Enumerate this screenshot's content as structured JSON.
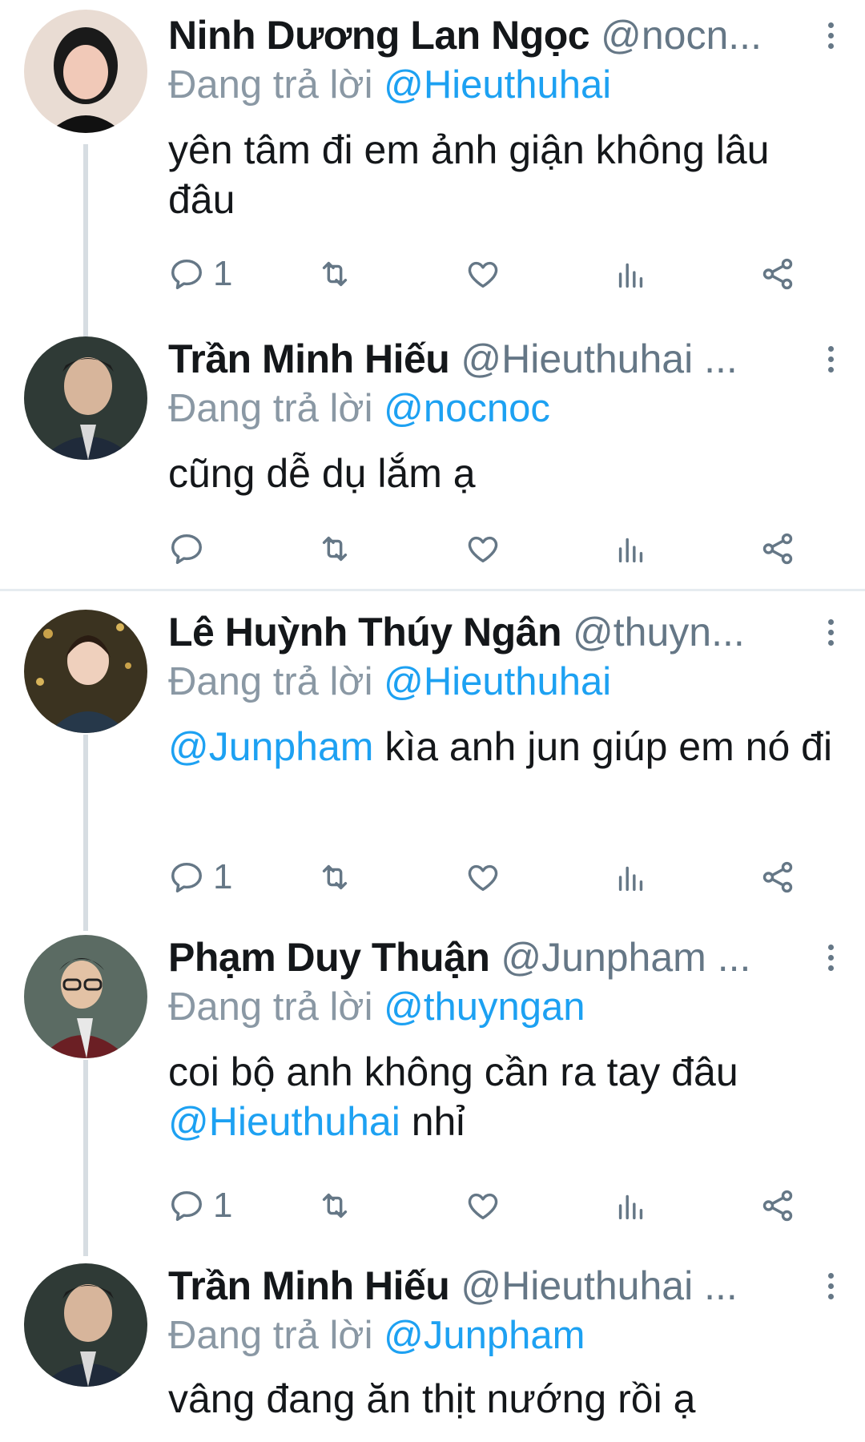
{
  "tweets": [
    {
      "name": "Ninh Dương Lan Ngọc",
      "handle": "@nocn...",
      "reply_label": "Đang trả lời",
      "reply_to": "@Hieuthuhai",
      "text": "yên tâm đi em ảnh giận không lâu đâu",
      "reply_count": "1",
      "avatar_colors": [
        "#e9dcd3",
        "#1a1a1a",
        "#f1c9b8"
      ]
    },
    {
      "name": "Trần Minh Hiếu",
      "handle": "@Hieuthuhai ...",
      "reply_label": "Đang trả lời",
      "reply_to": "@nocnoc",
      "text": "cũng dễ dụ lắm ạ",
      "reply_count": "",
      "avatar_colors": [
        "#2f3a36",
        "#1f2a3a",
        "#d7b59b"
      ]
    },
    {
      "name": "Lê Huỳnh Thúy Ngân",
      "handle": "@thuyn...",
      "reply_label": "Đang trả lời",
      "reply_to": "@Hieuthuhai",
      "text_mention": "@Junpham",
      "text": " kìa anh jun giúp em nó đi",
      "reply_count": "1",
      "avatar_colors": [
        "#3b3320",
        "#26384a",
        "#efd0bd"
      ]
    },
    {
      "name": "Phạm Duy Thuận",
      "handle": "@Junpham ...",
      "reply_label": "Đang trả lời",
      "reply_to": "@thuyngan",
      "text": "coi bộ anh không cần ra tay đâu ",
      "text_mention_end": "@Hieuthuhai",
      "text_end": " nhỉ",
      "reply_count": "1",
      "avatar_colors": [
        "#5b6b63",
        "#6b1f24",
        "#e3c2a5"
      ]
    },
    {
      "name": "Trần Minh Hiếu",
      "handle": "@Hieuthuhai ...",
      "reply_label": "Đang trả lời",
      "reply_to": "@Junpham",
      "text": "vâng đang ăn thịt nướng rồi ạ",
      "reply_count": "",
      "avatar_colors": [
        "#2f3a36",
        "#1f2a3a",
        "#d7b59b"
      ]
    }
  ],
  "colors": {
    "link": "#1da1f2",
    "secondary_text": "#657786",
    "thread_line": "#d7dde2"
  },
  "icons": [
    "reply-icon",
    "retweet-icon",
    "like-icon",
    "analytics-icon",
    "share-icon",
    "more-icon"
  ]
}
